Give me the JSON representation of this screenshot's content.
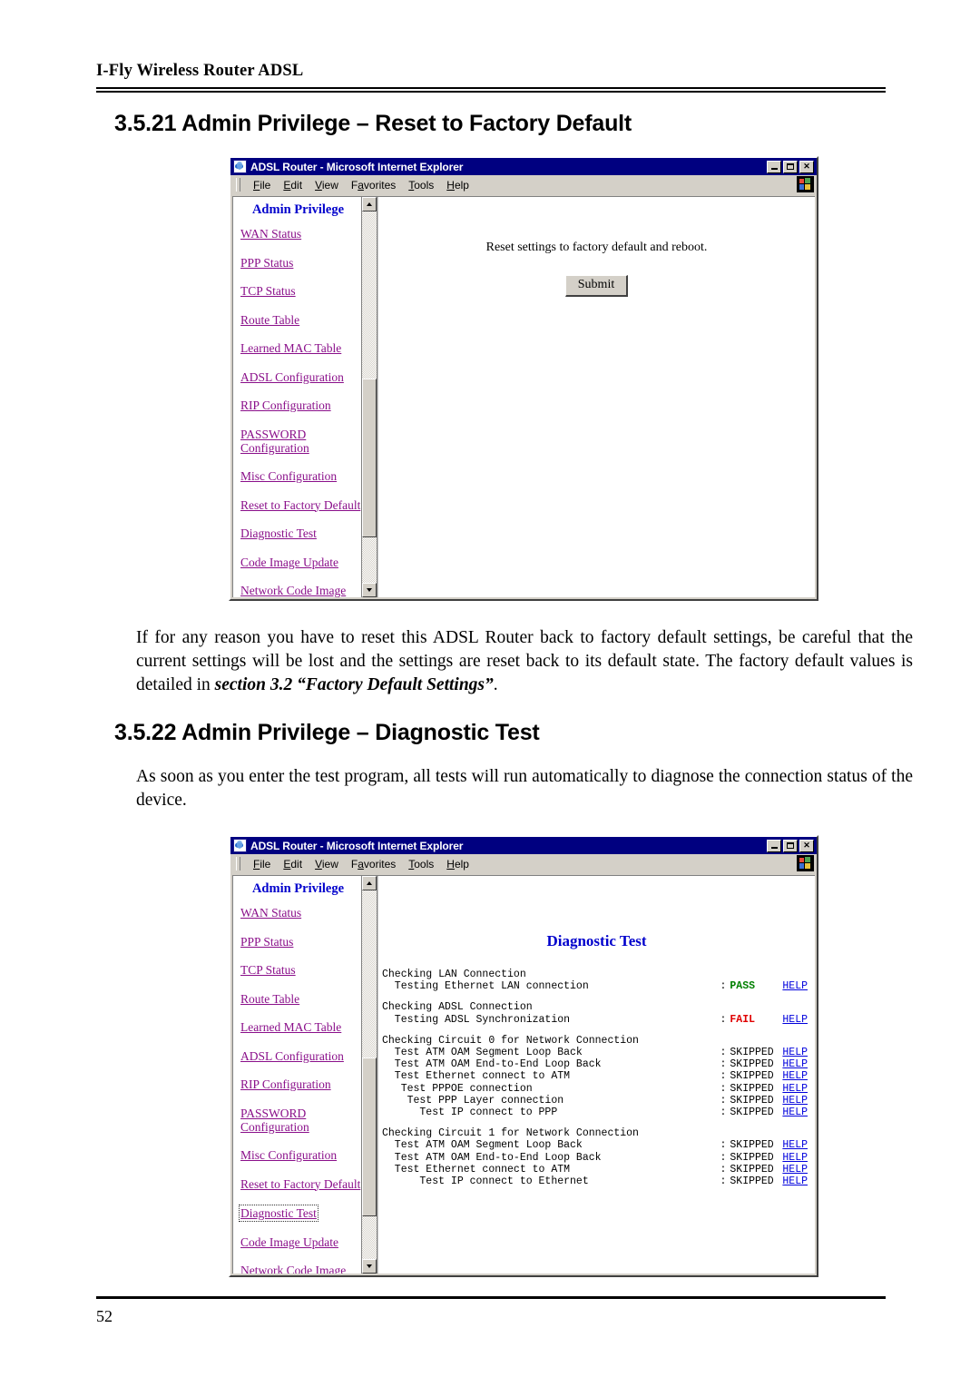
{
  "page": {
    "running_head": "I-Fly Wireless Router ADSL",
    "folio": "52"
  },
  "sections": {
    "reset": {
      "heading": "3.5.21 Admin Privilege – Reset to Factory Default",
      "paragraph_part1": "If for any reason you have to reset this ADSL Router back to factory default settings, be careful that the current settings will be lost and the settings are reset back to its default state. The factory default values is detailed in ",
      "paragraph_emphasis": "section 3.2 “Factory Default Settings”",
      "paragraph_part2": "."
    },
    "diagnostic": {
      "heading": "3.5.22 Admin Privilege – Diagnostic Test",
      "paragraph": "As soon as you enter the test program, all tests will run automatically to diagnose the connection status of the device."
    }
  },
  "browser": {
    "title": "ADSL Router - Microsoft Internet Explorer",
    "menu": [
      {
        "pre": "",
        "key": "F",
        "post": "ile"
      },
      {
        "pre": "",
        "key": "E",
        "post": "dit"
      },
      {
        "pre": "",
        "key": "V",
        "post": "iew"
      },
      {
        "pre": "F",
        "key": "a",
        "post": "vorites"
      },
      {
        "pre": "",
        "key": "T",
        "post": "ools"
      },
      {
        "pre": "",
        "key": "H",
        "post": "elp"
      }
    ],
    "window_buttons": {
      "minimize": "Minimize",
      "restore": "Restore",
      "close": "Close"
    }
  },
  "nav": {
    "title": "Admin Privilege",
    "items": [
      "WAN Status",
      "PPP Status",
      "TCP Status",
      "Route Table",
      "Learned MAC Table",
      "ADSL Configuration",
      "RIP Configuration",
      "PASSWORD Configuration",
      "Misc Configuration",
      "Reset to Factory Default",
      "Diagnostic Test",
      "Code Image Update",
      "Network Code Image"
    ],
    "link_color": "#8a0f8a",
    "title_color": "#0000cc"
  },
  "reset_panel": {
    "message": "Reset settings to factory default and reboot.",
    "submit_label": "Submit"
  },
  "diagnostic_panel": {
    "title": "Diagnostic Test",
    "colon": ":",
    "help_label": "HELP",
    "colors": {
      "pass": "#008000",
      "fail": "#e00000",
      "help": "#0000dd",
      "title": "#0000cc"
    },
    "groups": [
      {
        "header": "Checking LAN Connection",
        "rows": [
          {
            "indent": 2,
            "label": "Testing Ethernet LAN connection",
            "result": "PASS",
            "state": "pass",
            "help": "HELP"
          }
        ]
      },
      {
        "header": "Checking ADSL Connection",
        "rows": [
          {
            "indent": 2,
            "label": "Testing ADSL Synchronization",
            "result": "FAIL",
            "state": "fail",
            "help": "HELP"
          }
        ]
      },
      {
        "header": "Checking Circuit 0 for Network Connection",
        "rows": [
          {
            "indent": 2,
            "label": "Test ATM OAM Segment Loop Back",
            "result": "SKIPPED",
            "state": "skipped",
            "help": "HELP"
          },
          {
            "indent": 2,
            "label": "Test ATM OAM End-to-End Loop Back",
            "result": "SKIPPED",
            "state": "skipped",
            "help": "HELP"
          },
          {
            "indent": 2,
            "label": "Test Ethernet connect to ATM",
            "result": "SKIPPED",
            "state": "skipped",
            "help": "HELP"
          },
          {
            "indent": 3,
            "label": "Test PPPOE connection",
            "result": "SKIPPED",
            "state": "skipped",
            "help": "HELP"
          },
          {
            "indent": 4,
            "label": "Test PPP Layer connection",
            "result": "SKIPPED",
            "state": "skipped",
            "help": "HELP"
          },
          {
            "indent": 6,
            "label": "Test IP connect to PPP",
            "result": "SKIPPED",
            "state": "skipped",
            "help": "HELP"
          }
        ]
      },
      {
        "header": "Checking Circuit 1 for Network Connection",
        "rows": [
          {
            "indent": 2,
            "label": "Test ATM OAM Segment Loop Back",
            "result": "SKIPPED",
            "state": "skipped",
            "help": "HELP"
          },
          {
            "indent": 2,
            "label": "Test ATM OAM End-to-End Loop Back",
            "result": "SKIPPED",
            "state": "skipped",
            "help": "HELP"
          },
          {
            "indent": 2,
            "label": "Test Ethernet connect to ATM",
            "result": "SKIPPED",
            "state": "skipped",
            "help": "HELP"
          },
          {
            "indent": 6,
            "label": "Test IP connect to Ethernet",
            "result": "SKIPPED",
            "state": "skipped",
            "help": "HELP"
          }
        ]
      }
    ]
  }
}
